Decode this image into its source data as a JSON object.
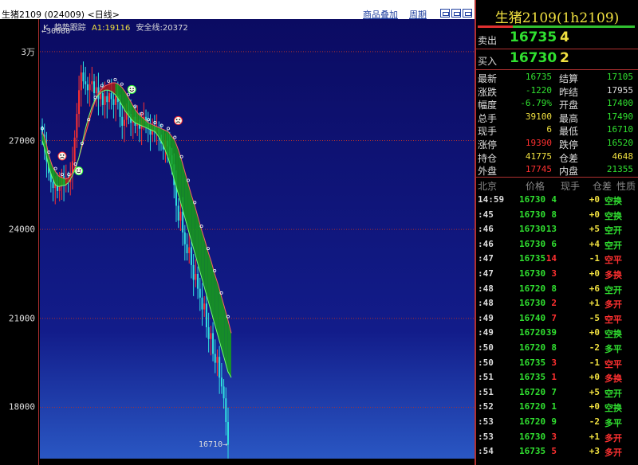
{
  "header": {
    "title": "生猪2109 (024009) <日线>",
    "links": [
      "商品叠加",
      "周期"
    ]
  },
  "legend": {
    "k": "K",
    "trend": "趋势跟踪",
    "a1": "A1:19116",
    "safe": "安全线:20372"
  },
  "chart_data": {
    "type": "candlestick",
    "y_ticks": [
      {
        "label": "3万",
        "value": 30000
      },
      {
        "label": "27000",
        "value": 27000
      },
      {
        "label": "24000",
        "value": 24000
      },
      {
        "label": "21000",
        "value": 21000
      },
      {
        "label": "18000",
        "value": 18000
      }
    ],
    "ylim": [
      16050,
      31100
    ],
    "high_marker": {
      "label": "←30680",
      "value": 30680
    },
    "low_marker": {
      "label": "16710→",
      "value": 16710
    },
    "grid": true,
    "colors": {
      "up": "#ff3030",
      "down": "#30e0e0",
      "trend_up_fill": "#b01818",
      "trend_down_fill": "#18a018",
      "line": "#ffffff"
    },
    "closes": [
      27200,
      26800,
      26300,
      25900,
      25600,
      25400,
      25550,
      25300,
      25450,
      25800,
      25500,
      25700,
      25600,
      25900,
      26300,
      27100,
      27900,
      28700,
      29300,
      29000,
      28900,
      28700,
      28900,
      29000,
      28600,
      28800,
      28400,
      28600,
      28200,
      28500,
      28300,
      28600,
      28400,
      28200,
      28500,
      28300,
      27800,
      27500,
      27700,
      28000,
      27900,
      27600,
      27800,
      27500,
      27700,
      27400,
      27600,
      27800,
      27600,
      27400,
      27200,
      27500,
      27300,
      27400,
      27200,
      26900,
      26700,
      27000,
      26800,
      26500,
      26200,
      25500,
      24800,
      24300,
      24600,
      23900,
      23500,
      23200,
      23400,
      22800,
      22300,
      22500,
      22000,
      21700,
      21300,
      21500,
      20700,
      20300,
      20500,
      19800,
      19500,
      19700,
      19000,
      18700,
      18300,
      17500,
      16735
    ],
    "trend_upper": [
      27300,
      27000,
      26500,
      26150,
      25950,
      25800,
      25750,
      25700,
      25750,
      25900,
      26100,
      26400,
      26800,
      27200,
      27600,
      28000,
      28350,
      28600,
      28750,
      28850,
      28900,
      28950,
      28950,
      28900,
      28800,
      28650,
      28450,
      28250,
      28050,
      27900,
      27800,
      27700,
      27600,
      27550,
      27500,
      27450,
      27400,
      27350,
      27300,
      27150,
      27000,
      26700,
      26350,
      25950,
      25550,
      25150,
      24800,
      24400,
      24000,
      23650,
      23250,
      22900,
      22500,
      22150,
      21750,
      21350,
      20950,
      20500
    ],
    "trend_lower": [
      27000,
      26600,
      26100,
      25750,
      25500,
      25450,
      25480,
      25500,
      25600,
      25800,
      26050,
      26400,
      26900,
      27400,
      27800,
      28150,
      28400,
      28550,
      28650,
      28700,
      28700,
      28650,
      28550,
      28400,
      28200,
      28000,
      27850,
      27700,
      27600,
      27550,
      27500,
      27450,
      27400,
      27350,
      27300,
      27150,
      26950,
      26700,
      26400,
      26000,
      25600,
      25200,
      24800,
      24400,
      24000,
      23600,
      23200,
      22800,
      22400,
      22000,
      21600,
      21200,
      20800,
      20400,
      20000,
      19600,
      19200,
      19000
    ]
  },
  "quote": {
    "title": "生猪2109(1h2109)",
    "orderbook": [
      {
        "label": "卖出",
        "price": "16735",
        "vol": "4"
      },
      {
        "label": "买入",
        "price": "16730",
        "vol": "2"
      }
    ],
    "stats": [
      {
        "l1": "最新",
        "v1": "16735",
        "c1": "g",
        "l2": "结算",
        "v2": "17105",
        "c2": "g"
      },
      {
        "l1": "涨跌",
        "v1": "-1220",
        "c1": "g",
        "l2": "昨结",
        "v2": "17955",
        "c2": "w"
      },
      {
        "l1": "幅度",
        "v1": "-6.79%",
        "c1": "g",
        "l2": "开盘",
        "v2": "17400",
        "c2": "g"
      },
      {
        "l1": "总手",
        "v1": "39100",
        "c1": "y",
        "l2": "最高",
        "v2": "17490",
        "c2": "g"
      },
      {
        "l1": "现手",
        "v1": "6",
        "c1": "y",
        "l2": "最低",
        "v2": "16710",
        "c2": "g"
      },
      {
        "l1": "涨停",
        "v1": "19390",
        "c1": "r",
        "l2": "跌停",
        "v2": "16520",
        "c2": "g"
      },
      {
        "l1": "持仓",
        "v1": "41775",
        "c1": "y",
        "l2": "仓差",
        "v2": "4648",
        "c2": "y"
      },
      {
        "l1": "外盘",
        "v1": "17745",
        "c1": "r",
        "l2": "内盘",
        "v2": "21355",
        "c2": "g"
      }
    ],
    "tick_header": [
      "北京",
      "价格",
      "现手",
      "仓差",
      "性质"
    ],
    "ticks": [
      {
        "time": "14:59",
        "price": "16730",
        "vol": "4",
        "vc": "g",
        "oi": "+0",
        "oc": "y",
        "nat": "空换",
        "nc": "g"
      },
      {
        "time": ":45",
        "price": "16730",
        "vol": "8",
        "vc": "g",
        "oi": "+0",
        "oc": "y",
        "nat": "空换",
        "nc": "g"
      },
      {
        "time": ":46",
        "price": "16730",
        "vol": "13",
        "vc": "g",
        "oi": "+5",
        "oc": "y",
        "nat": "空开",
        "nc": "g"
      },
      {
        "time": ":46",
        "price": "16730",
        "vol": "6",
        "vc": "g",
        "oi": "+4",
        "oc": "y",
        "nat": "空开",
        "nc": "g"
      },
      {
        "time": ":47",
        "price": "16735",
        "vol": "14",
        "vc": "r",
        "oi": "-1",
        "oc": "y",
        "nat": "空平",
        "nc": "r"
      },
      {
        "time": ":47",
        "price": "16730",
        "vol": "3",
        "vc": "r",
        "oi": "+0",
        "oc": "y",
        "nat": "多换",
        "nc": "r"
      },
      {
        "time": ":48",
        "price": "16720",
        "vol": "8",
        "vc": "g",
        "oi": "+6",
        "oc": "y",
        "nat": "空开",
        "nc": "g"
      },
      {
        "time": ":48",
        "price": "16730",
        "vol": "2",
        "vc": "r",
        "oi": "+1",
        "oc": "y",
        "nat": "多开",
        "nc": "r"
      },
      {
        "time": ":49",
        "price": "16740",
        "vol": "7",
        "vc": "r",
        "oi": "-5",
        "oc": "y",
        "nat": "空平",
        "nc": "r"
      },
      {
        "time": ":49",
        "price": "16720",
        "vol": "39",
        "vc": "g",
        "oi": "+0",
        "oc": "y",
        "nat": "空换",
        "nc": "g"
      },
      {
        "time": ":50",
        "price": "16720",
        "vol": "8",
        "vc": "g",
        "oi": "-2",
        "oc": "y",
        "nat": "多平",
        "nc": "g"
      },
      {
        "time": ":50",
        "price": "16735",
        "vol": "3",
        "vc": "r",
        "oi": "-1",
        "oc": "y",
        "nat": "空平",
        "nc": "r"
      },
      {
        "time": ":51",
        "price": "16735",
        "vol": "1",
        "vc": "r",
        "oi": "+0",
        "oc": "y",
        "nat": "多换",
        "nc": "r"
      },
      {
        "time": ":51",
        "price": "16720",
        "vol": "7",
        "vc": "g",
        "oi": "+5",
        "oc": "y",
        "nat": "空开",
        "nc": "g"
      },
      {
        "time": ":52",
        "price": "16720",
        "vol": "1",
        "vc": "g",
        "oi": "+0",
        "oc": "y",
        "nat": "空换",
        "nc": "g"
      },
      {
        "time": ":53",
        "price": "16720",
        "vol": "9",
        "vc": "g",
        "oi": "-2",
        "oc": "y",
        "nat": "多平",
        "nc": "g"
      },
      {
        "time": ":53",
        "price": "16730",
        "vol": "3",
        "vc": "r",
        "oi": "+1",
        "oc": "y",
        "nat": "多开",
        "nc": "r"
      },
      {
        "time": ":54",
        "price": "16735",
        "vol": "5",
        "vc": "r",
        "oi": "+3",
        "oc": "y",
        "nat": "多开",
        "nc": "r"
      }
    ]
  }
}
